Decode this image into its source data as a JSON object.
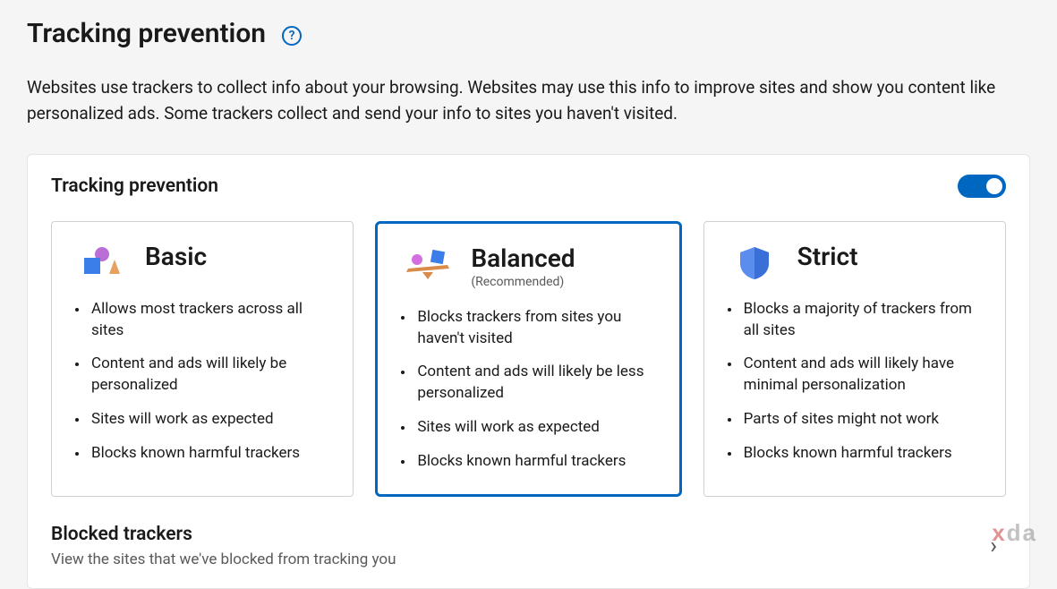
{
  "header": {
    "title": "Tracking prevention",
    "description": "Websites use trackers to collect info about your browsing. Websites may use this info to improve sites and show you content like personalized ads. Some trackers collect and send your info to sites you haven't visited."
  },
  "panel": {
    "title": "Tracking prevention",
    "toggle_on": true
  },
  "cards": {
    "basic": {
      "title": "Basic",
      "bullets": [
        "Allows most trackers across all sites",
        "Content and ads will likely be personalized",
        "Sites will work as expected",
        "Blocks known harmful trackers"
      ]
    },
    "balanced": {
      "title": "Balanced",
      "subtitle": "(Recommended)",
      "bullets": [
        "Blocks trackers from sites you haven't visited",
        "Content and ads will likely be less personalized",
        "Sites will work as expected",
        "Blocks known harmful trackers"
      ]
    },
    "strict": {
      "title": "Strict",
      "bullets": [
        "Blocks a majority of trackers from all sites",
        "Content and ads will likely have minimal personalization",
        "Parts of sites might not work",
        "Blocks known harmful trackers"
      ]
    }
  },
  "blocked": {
    "title": "Blocked trackers",
    "description": "View the sites that we've blocked from tracking you"
  },
  "watermark": {
    "prefix": "x",
    "suffix": "da"
  }
}
